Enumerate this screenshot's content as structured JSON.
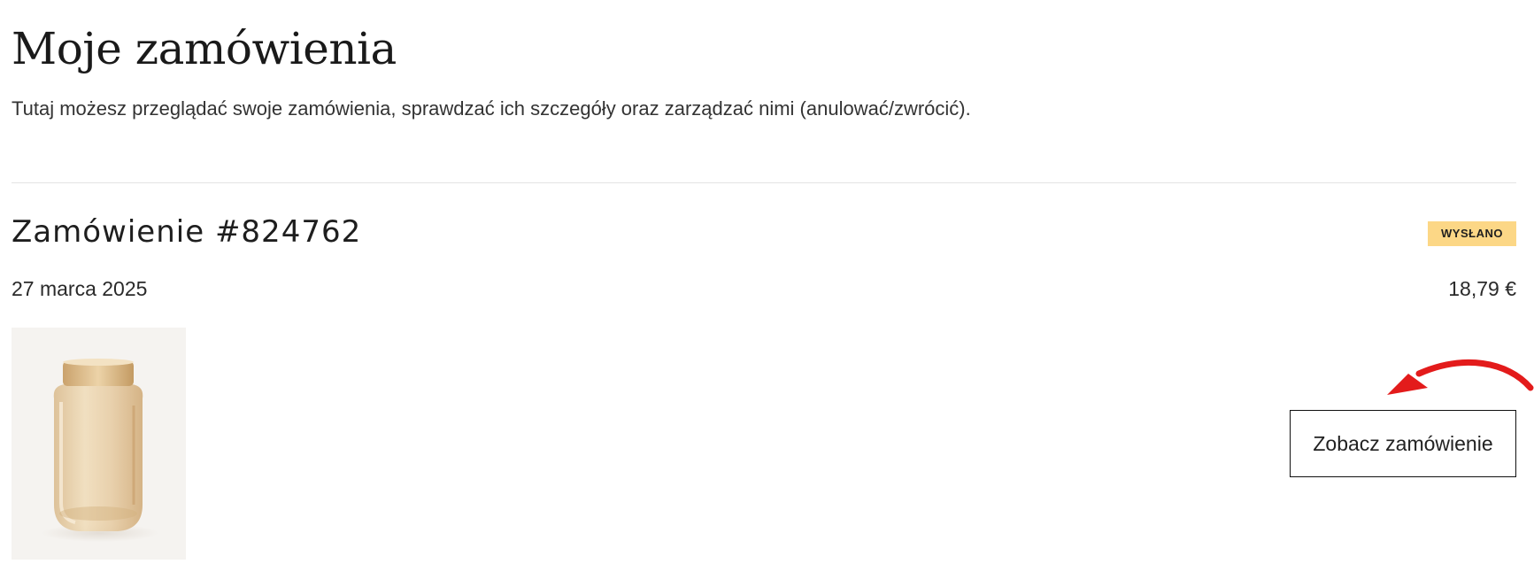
{
  "page": {
    "title": "Moje zamówienia",
    "subtitle": "Tutaj możesz przeglądać swoje zamówienia, sprawdzać ich szczegóły oraz zarządzać nimi (anulować/zwrócić)."
  },
  "orders": [
    {
      "number": "Zamówienie #824762",
      "status": "WYSŁANO",
      "date": "27 marca 2025",
      "total": "18,79 €",
      "product_image": "glass-vase",
      "view_button_label": "Zobacz zamówienie"
    }
  ],
  "colors": {
    "status_badge": "#fcd786",
    "annotation_arrow": "#e31b1b",
    "divider": "#e4e4e4"
  }
}
